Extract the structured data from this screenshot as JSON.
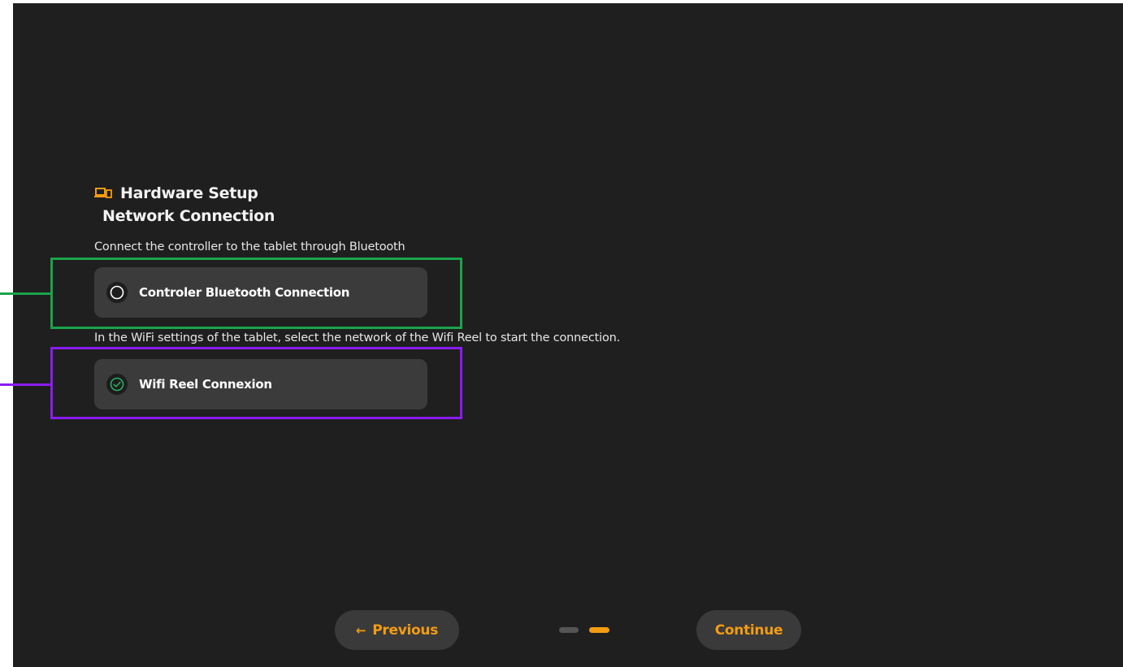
{
  "header": {
    "title": "Hardware Setup",
    "subtitle": "Network Connection",
    "icon": "devices-icon"
  },
  "steps": [
    {
      "instruction": "Connect the controller to the tablet through Bluetooth",
      "label": "Controler Bluetooth Connection",
      "status": "pending",
      "icon": "radio-empty-icon"
    },
    {
      "instruction": "In the WiFi settings of the tablet, select the network of the Wifi Reel to start the connection.",
      "label": "Wifi Reel Connexion",
      "status": "connected",
      "icon": "check-circle-icon"
    }
  ],
  "nav": {
    "previous_arrow": "←",
    "previous_label": "Previous",
    "continue_label": "Continue",
    "total_pages": 2,
    "current_page": 2
  },
  "colors": {
    "background": "#1f1f1f",
    "card": "#3b3b3b",
    "accent": "#f39c12",
    "success": "#27ae60",
    "highlight_bluetooth": "#1aa34a",
    "highlight_wifi": "#8a1cf0",
    "dot_inactive": "#555555"
  }
}
